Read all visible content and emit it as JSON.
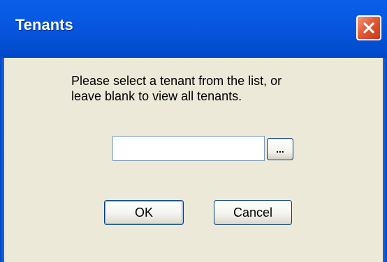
{
  "window": {
    "title": "Tenants",
    "close_icon": "close-icon"
  },
  "dialog": {
    "prompt_line1": "Please select a tenant from the list, or",
    "prompt_line2": "leave blank to view all tenants.",
    "tenant_value": "",
    "browse_label": "...",
    "ok_label": "OK",
    "cancel_label": "Cancel"
  },
  "colors": {
    "titlebar": "#0a5fe8",
    "client_background": "#ece9d8",
    "close_button": "#e25a36",
    "button_border": "#003c74"
  }
}
